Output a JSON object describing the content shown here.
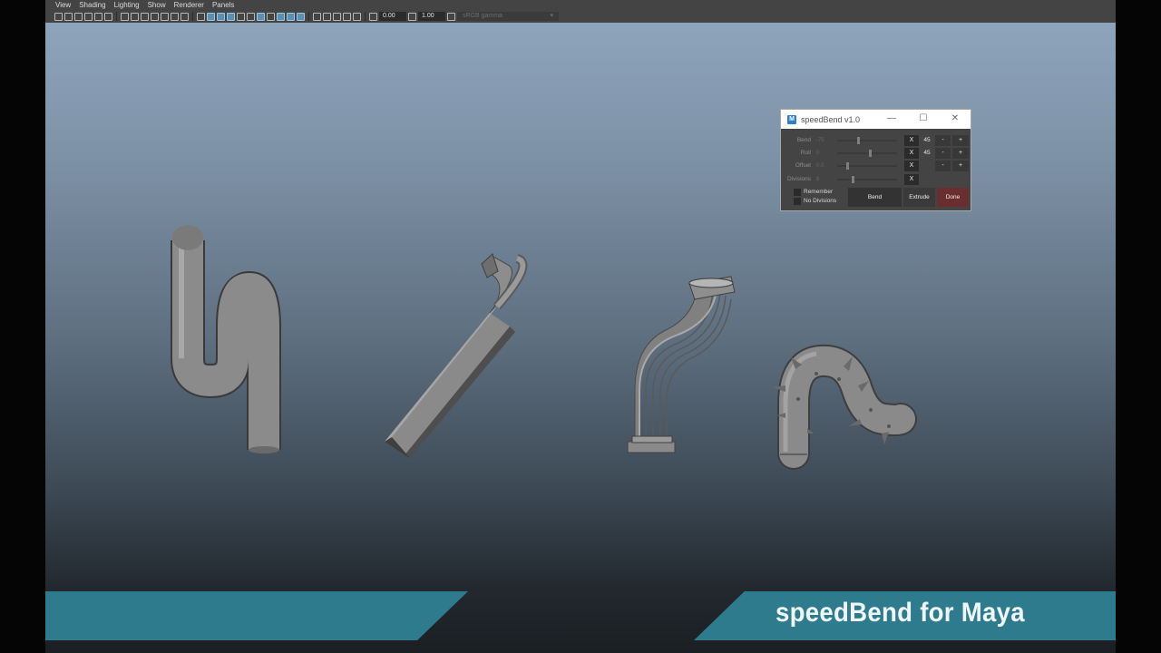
{
  "menu": [
    "View",
    "Shading",
    "Lighting",
    "Show",
    "Renderer",
    "Panels"
  ],
  "toolbar": {
    "exposure_value": "0.00",
    "gamma_value": "1.00",
    "color_space": "sRGB gamma"
  },
  "dialog": {
    "app_icon": "M",
    "title": "speedBend v1.0",
    "minimize": "—",
    "maximize": "☐",
    "close": "✕",
    "rows": [
      {
        "label": "Bend",
        "value": "-75",
        "x": "X",
        "num": "45",
        "minus": "-",
        "plus": "+"
      },
      {
        "label": "Roll",
        "value": "0",
        "x": "X",
        "num": "45",
        "minus": "-",
        "plus": "+"
      },
      {
        "label": "Offset",
        "value": "0.0",
        "x": "X",
        "minus": "-",
        "plus": "+"
      },
      {
        "label": "Divisions",
        "value": "8",
        "x": "X"
      }
    ],
    "remember_label": "Remember",
    "no_divisions_label": "No Divisions",
    "bend_button": "Bend",
    "extrude_button": "Extrude",
    "done_button": "Done"
  },
  "banner": {
    "title": "speedBend for Maya"
  },
  "colors": {
    "banner": "#2f7b8e",
    "done_button": "#6a2e2e",
    "dialog_bg": "#444444"
  }
}
